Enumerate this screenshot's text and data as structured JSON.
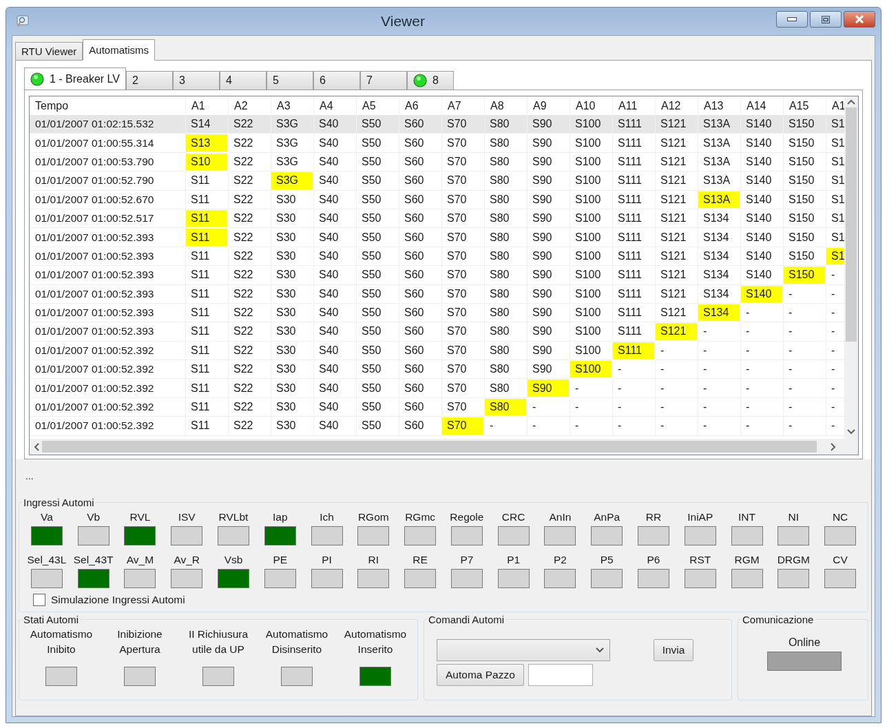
{
  "window": {
    "title": "Viewer"
  },
  "tabs": [
    {
      "label": "RTU Viewer",
      "selected": false
    },
    {
      "label": "Automatisms",
      "selected": true
    }
  ],
  "inner_tabs": [
    {
      "label": "1 - Breaker LV",
      "selected": true,
      "led": true
    },
    {
      "label": "2",
      "selected": false,
      "led": false
    },
    {
      "label": "3",
      "selected": false,
      "led": false
    },
    {
      "label": "4",
      "selected": false,
      "led": false
    },
    {
      "label": "5",
      "selected": false,
      "led": false
    },
    {
      "label": "6",
      "selected": false,
      "led": false
    },
    {
      "label": "7",
      "selected": false,
      "led": false
    },
    {
      "label": "8",
      "selected": false,
      "led": true
    }
  ],
  "table": {
    "time_header": "Tempo",
    "columns": [
      "A1",
      "A2",
      "A3",
      "A4",
      "A5",
      "A6",
      "A7",
      "A8",
      "A9",
      "A10",
      "A11",
      "A12",
      "A13",
      "A14",
      "A15",
      "A1"
    ],
    "rows": [
      {
        "time": "01/01/2007 01:02:15.532",
        "selected": true,
        "cells": [
          {
            "text": "S14",
            "highlighted": false
          },
          {
            "text": "S22",
            "highlighted": false
          },
          {
            "text": "S3G",
            "highlighted": false
          },
          {
            "text": "S40",
            "highlighted": false
          },
          {
            "text": "S50",
            "highlighted": false
          },
          {
            "text": "S60",
            "highlighted": false
          },
          {
            "text": "S70",
            "highlighted": false
          },
          {
            "text": "S80",
            "highlighted": false
          },
          {
            "text": "S90",
            "highlighted": false
          },
          {
            "text": "S100",
            "highlighted": false
          },
          {
            "text": "S111",
            "highlighted": false
          },
          {
            "text": "S121",
            "highlighted": false
          },
          {
            "text": "S13A",
            "highlighted": false
          },
          {
            "text": "S140",
            "highlighted": false
          },
          {
            "text": "S150",
            "highlighted": false
          },
          {
            "text": "S1",
            "highlighted": false
          }
        ]
      },
      {
        "time": "01/01/2007 01:00:55.314",
        "selected": false,
        "cells": [
          {
            "text": "S13",
            "highlighted": true
          },
          {
            "text": "S22",
            "highlighted": false
          },
          {
            "text": "S3G",
            "highlighted": false
          },
          {
            "text": "S40",
            "highlighted": false
          },
          {
            "text": "S50",
            "highlighted": false
          },
          {
            "text": "S60",
            "highlighted": false
          },
          {
            "text": "S70",
            "highlighted": false
          },
          {
            "text": "S80",
            "highlighted": false
          },
          {
            "text": "S90",
            "highlighted": false
          },
          {
            "text": "S100",
            "highlighted": false
          },
          {
            "text": "S111",
            "highlighted": false
          },
          {
            "text": "S121",
            "highlighted": false
          },
          {
            "text": "S13A",
            "highlighted": false
          },
          {
            "text": "S140",
            "highlighted": false
          },
          {
            "text": "S150",
            "highlighted": false
          },
          {
            "text": "S1",
            "highlighted": false
          }
        ]
      },
      {
        "time": "01/01/2007 01:00:53.790",
        "selected": false,
        "cells": [
          {
            "text": "S10",
            "highlighted": true
          },
          {
            "text": "S22",
            "highlighted": false
          },
          {
            "text": "S3G",
            "highlighted": false
          },
          {
            "text": "S40",
            "highlighted": false
          },
          {
            "text": "S50",
            "highlighted": false
          },
          {
            "text": "S60",
            "highlighted": false
          },
          {
            "text": "S70",
            "highlighted": false
          },
          {
            "text": "S80",
            "highlighted": false
          },
          {
            "text": "S90",
            "highlighted": false
          },
          {
            "text": "S100",
            "highlighted": false
          },
          {
            "text": "S111",
            "highlighted": false
          },
          {
            "text": "S121",
            "highlighted": false
          },
          {
            "text": "S13A",
            "highlighted": false
          },
          {
            "text": "S140",
            "highlighted": false
          },
          {
            "text": "S150",
            "highlighted": false
          },
          {
            "text": "S1",
            "highlighted": false
          }
        ]
      },
      {
        "time": "01/01/2007 01:00:52.790",
        "selected": false,
        "cells": [
          {
            "text": "S11",
            "highlighted": false
          },
          {
            "text": "S22",
            "highlighted": false
          },
          {
            "text": "S3G",
            "highlighted": true
          },
          {
            "text": "S40",
            "highlighted": false
          },
          {
            "text": "S50",
            "highlighted": false
          },
          {
            "text": "S60",
            "highlighted": false
          },
          {
            "text": "S70",
            "highlighted": false
          },
          {
            "text": "S80",
            "highlighted": false
          },
          {
            "text": "S90",
            "highlighted": false
          },
          {
            "text": "S100",
            "highlighted": false
          },
          {
            "text": "S111",
            "highlighted": false
          },
          {
            "text": "S121",
            "highlighted": false
          },
          {
            "text": "S13A",
            "highlighted": false
          },
          {
            "text": "S140",
            "highlighted": false
          },
          {
            "text": "S150",
            "highlighted": false
          },
          {
            "text": "S1",
            "highlighted": false
          }
        ]
      },
      {
        "time": "01/01/2007 01:00:52.670",
        "selected": false,
        "cells": [
          {
            "text": "S11",
            "highlighted": false
          },
          {
            "text": "S22",
            "highlighted": false
          },
          {
            "text": "S30",
            "highlighted": false
          },
          {
            "text": "S40",
            "highlighted": false
          },
          {
            "text": "S50",
            "highlighted": false
          },
          {
            "text": "S60",
            "highlighted": false
          },
          {
            "text": "S70",
            "highlighted": false
          },
          {
            "text": "S80",
            "highlighted": false
          },
          {
            "text": "S90",
            "highlighted": false
          },
          {
            "text": "S100",
            "highlighted": false
          },
          {
            "text": "S111",
            "highlighted": false
          },
          {
            "text": "S121",
            "highlighted": false
          },
          {
            "text": "S13A",
            "highlighted": true
          },
          {
            "text": "S140",
            "highlighted": false
          },
          {
            "text": "S150",
            "highlighted": false
          },
          {
            "text": "S1",
            "highlighted": false
          }
        ]
      },
      {
        "time": "01/01/2007 01:00:52.517",
        "selected": false,
        "cells": [
          {
            "text": "S11",
            "highlighted": true
          },
          {
            "text": "S22",
            "highlighted": false
          },
          {
            "text": "S30",
            "highlighted": false
          },
          {
            "text": "S40",
            "highlighted": false
          },
          {
            "text": "S50",
            "highlighted": false
          },
          {
            "text": "S60",
            "highlighted": false
          },
          {
            "text": "S70",
            "highlighted": false
          },
          {
            "text": "S80",
            "highlighted": false
          },
          {
            "text": "S90",
            "highlighted": false
          },
          {
            "text": "S100",
            "highlighted": false
          },
          {
            "text": "S111",
            "highlighted": false
          },
          {
            "text": "S121",
            "highlighted": false
          },
          {
            "text": "S134",
            "highlighted": false
          },
          {
            "text": "S140",
            "highlighted": false
          },
          {
            "text": "S150",
            "highlighted": false
          },
          {
            "text": "S1",
            "highlighted": false
          }
        ]
      },
      {
        "time": "01/01/2007 01:00:52.393",
        "selected": false,
        "cells": [
          {
            "text": "S11",
            "highlighted": true
          },
          {
            "text": "S22",
            "highlighted": false
          },
          {
            "text": "S30",
            "highlighted": false
          },
          {
            "text": "S40",
            "highlighted": false
          },
          {
            "text": "S50",
            "highlighted": false
          },
          {
            "text": "S60",
            "highlighted": false
          },
          {
            "text": "S70",
            "highlighted": false
          },
          {
            "text": "S80",
            "highlighted": false
          },
          {
            "text": "S90",
            "highlighted": false
          },
          {
            "text": "S100",
            "highlighted": false
          },
          {
            "text": "S111",
            "highlighted": false
          },
          {
            "text": "S121",
            "highlighted": false
          },
          {
            "text": "S134",
            "highlighted": false
          },
          {
            "text": "S140",
            "highlighted": false
          },
          {
            "text": "S150",
            "highlighted": false
          },
          {
            "text": "S1",
            "highlighted": false
          }
        ]
      },
      {
        "time": "01/01/2007 01:00:52.393",
        "selected": false,
        "cells": [
          {
            "text": "S11",
            "highlighted": false
          },
          {
            "text": "S22",
            "highlighted": false
          },
          {
            "text": "S30",
            "highlighted": false
          },
          {
            "text": "S40",
            "highlighted": false
          },
          {
            "text": "S50",
            "highlighted": false
          },
          {
            "text": "S60",
            "highlighted": false
          },
          {
            "text": "S70",
            "highlighted": false
          },
          {
            "text": "S80",
            "highlighted": false
          },
          {
            "text": "S90",
            "highlighted": false
          },
          {
            "text": "S100",
            "highlighted": false
          },
          {
            "text": "S111",
            "highlighted": false
          },
          {
            "text": "S121",
            "highlighted": false
          },
          {
            "text": "S134",
            "highlighted": false
          },
          {
            "text": "S140",
            "highlighted": false
          },
          {
            "text": "S150",
            "highlighted": false
          },
          {
            "text": "S1",
            "highlighted": true
          }
        ]
      },
      {
        "time": "01/01/2007 01:00:52.393",
        "selected": false,
        "cells": [
          {
            "text": "S11",
            "highlighted": false
          },
          {
            "text": "S22",
            "highlighted": false
          },
          {
            "text": "S30",
            "highlighted": false
          },
          {
            "text": "S40",
            "highlighted": false
          },
          {
            "text": "S50",
            "highlighted": false
          },
          {
            "text": "S60",
            "highlighted": false
          },
          {
            "text": "S70",
            "highlighted": false
          },
          {
            "text": "S80",
            "highlighted": false
          },
          {
            "text": "S90",
            "highlighted": false
          },
          {
            "text": "S100",
            "highlighted": false
          },
          {
            "text": "S111",
            "highlighted": false
          },
          {
            "text": "S121",
            "highlighted": false
          },
          {
            "text": "S134",
            "highlighted": false
          },
          {
            "text": "S140",
            "highlighted": false
          },
          {
            "text": "S150",
            "highlighted": true
          },
          {
            "text": "-",
            "highlighted": false
          }
        ]
      },
      {
        "time": "01/01/2007 01:00:52.393",
        "selected": false,
        "cells": [
          {
            "text": "S11",
            "highlighted": false
          },
          {
            "text": "S22",
            "highlighted": false
          },
          {
            "text": "S30",
            "highlighted": false
          },
          {
            "text": "S40",
            "highlighted": false
          },
          {
            "text": "S50",
            "highlighted": false
          },
          {
            "text": "S60",
            "highlighted": false
          },
          {
            "text": "S70",
            "highlighted": false
          },
          {
            "text": "S80",
            "highlighted": false
          },
          {
            "text": "S90",
            "highlighted": false
          },
          {
            "text": "S100",
            "highlighted": false
          },
          {
            "text": "S111",
            "highlighted": false
          },
          {
            "text": "S121",
            "highlighted": false
          },
          {
            "text": "S134",
            "highlighted": false
          },
          {
            "text": "S140",
            "highlighted": true
          },
          {
            "text": "-",
            "highlighted": false
          },
          {
            "text": "-",
            "highlighted": false
          }
        ]
      },
      {
        "time": "01/01/2007 01:00:52.393",
        "selected": false,
        "cells": [
          {
            "text": "S11",
            "highlighted": false
          },
          {
            "text": "S22",
            "highlighted": false
          },
          {
            "text": "S30",
            "highlighted": false
          },
          {
            "text": "S40",
            "highlighted": false
          },
          {
            "text": "S50",
            "highlighted": false
          },
          {
            "text": "S60",
            "highlighted": false
          },
          {
            "text": "S70",
            "highlighted": false
          },
          {
            "text": "S80",
            "highlighted": false
          },
          {
            "text": "S90",
            "highlighted": false
          },
          {
            "text": "S100",
            "highlighted": false
          },
          {
            "text": "S111",
            "highlighted": false
          },
          {
            "text": "S121",
            "highlighted": false
          },
          {
            "text": "S134",
            "highlighted": true
          },
          {
            "text": "-",
            "highlighted": false
          },
          {
            "text": "-",
            "highlighted": false
          },
          {
            "text": "-",
            "highlighted": false
          }
        ]
      },
      {
        "time": "01/01/2007 01:00:52.393",
        "selected": false,
        "cells": [
          {
            "text": "S11",
            "highlighted": false
          },
          {
            "text": "S22",
            "highlighted": false
          },
          {
            "text": "S30",
            "highlighted": false
          },
          {
            "text": "S40",
            "highlighted": false
          },
          {
            "text": "S50",
            "highlighted": false
          },
          {
            "text": "S60",
            "highlighted": false
          },
          {
            "text": "S70",
            "highlighted": false
          },
          {
            "text": "S80",
            "highlighted": false
          },
          {
            "text": "S90",
            "highlighted": false
          },
          {
            "text": "S100",
            "highlighted": false
          },
          {
            "text": "S111",
            "highlighted": false
          },
          {
            "text": "S121",
            "highlighted": true
          },
          {
            "text": "-",
            "highlighted": false
          },
          {
            "text": "-",
            "highlighted": false
          },
          {
            "text": "-",
            "highlighted": false
          },
          {
            "text": "-",
            "highlighted": false
          }
        ]
      },
      {
        "time": "01/01/2007 01:00:52.392",
        "selected": false,
        "cells": [
          {
            "text": "S11",
            "highlighted": false
          },
          {
            "text": "S22",
            "highlighted": false
          },
          {
            "text": "S30",
            "highlighted": false
          },
          {
            "text": "S40",
            "highlighted": false
          },
          {
            "text": "S50",
            "highlighted": false
          },
          {
            "text": "S60",
            "highlighted": false
          },
          {
            "text": "S70",
            "highlighted": false
          },
          {
            "text": "S80",
            "highlighted": false
          },
          {
            "text": "S90",
            "highlighted": false
          },
          {
            "text": "S100",
            "highlighted": false
          },
          {
            "text": "S111",
            "highlighted": true
          },
          {
            "text": "-",
            "highlighted": false
          },
          {
            "text": "-",
            "highlighted": false
          },
          {
            "text": "-",
            "highlighted": false
          },
          {
            "text": "-",
            "highlighted": false
          },
          {
            "text": "-",
            "highlighted": false
          }
        ]
      },
      {
        "time": "01/01/2007 01:00:52.392",
        "selected": false,
        "cells": [
          {
            "text": "S11",
            "highlighted": false
          },
          {
            "text": "S22",
            "highlighted": false
          },
          {
            "text": "S30",
            "highlighted": false
          },
          {
            "text": "S40",
            "highlighted": false
          },
          {
            "text": "S50",
            "highlighted": false
          },
          {
            "text": "S60",
            "highlighted": false
          },
          {
            "text": "S70",
            "highlighted": false
          },
          {
            "text": "S80",
            "highlighted": false
          },
          {
            "text": "S90",
            "highlighted": false
          },
          {
            "text": "S100",
            "highlighted": true
          },
          {
            "text": "-",
            "highlighted": false
          },
          {
            "text": "-",
            "highlighted": false
          },
          {
            "text": "-",
            "highlighted": false
          },
          {
            "text": "-",
            "highlighted": false
          },
          {
            "text": "-",
            "highlighted": false
          },
          {
            "text": "-",
            "highlighted": false
          }
        ]
      },
      {
        "time": "01/01/2007 01:00:52.392",
        "selected": false,
        "cells": [
          {
            "text": "S11",
            "highlighted": false
          },
          {
            "text": "S22",
            "highlighted": false
          },
          {
            "text": "S30",
            "highlighted": false
          },
          {
            "text": "S40",
            "highlighted": false
          },
          {
            "text": "S50",
            "highlighted": false
          },
          {
            "text": "S60",
            "highlighted": false
          },
          {
            "text": "S70",
            "highlighted": false
          },
          {
            "text": "S80",
            "highlighted": false
          },
          {
            "text": "S90",
            "highlighted": true
          },
          {
            "text": "-",
            "highlighted": false
          },
          {
            "text": "-",
            "highlighted": false
          },
          {
            "text": "-",
            "highlighted": false
          },
          {
            "text": "-",
            "highlighted": false
          },
          {
            "text": "-",
            "highlighted": false
          },
          {
            "text": "-",
            "highlighted": false
          },
          {
            "text": "-",
            "highlighted": false
          }
        ]
      },
      {
        "time": "01/01/2007 01:00:52.392",
        "selected": false,
        "cells": [
          {
            "text": "S11",
            "highlighted": false
          },
          {
            "text": "S22",
            "highlighted": false
          },
          {
            "text": "S30",
            "highlighted": false
          },
          {
            "text": "S40",
            "highlighted": false
          },
          {
            "text": "S50",
            "highlighted": false
          },
          {
            "text": "S60",
            "highlighted": false
          },
          {
            "text": "S70",
            "highlighted": false
          },
          {
            "text": "S80",
            "highlighted": true
          },
          {
            "text": "-",
            "highlighted": false
          },
          {
            "text": "-",
            "highlighted": false
          },
          {
            "text": "-",
            "highlighted": false
          },
          {
            "text": "-",
            "highlighted": false
          },
          {
            "text": "-",
            "highlighted": false
          },
          {
            "text": "-",
            "highlighted": false
          },
          {
            "text": "-",
            "highlighted": false
          },
          {
            "text": "-",
            "highlighted": false
          }
        ]
      },
      {
        "time": "01/01/2007 01:00:52.392",
        "selected": false,
        "cells": [
          {
            "text": "S11",
            "highlighted": false
          },
          {
            "text": "S22",
            "highlighted": false
          },
          {
            "text": "S30",
            "highlighted": false
          },
          {
            "text": "S40",
            "highlighted": false
          },
          {
            "text": "S50",
            "highlighted": false
          },
          {
            "text": "S60",
            "highlighted": false
          },
          {
            "text": "S70",
            "highlighted": true
          },
          {
            "text": "-",
            "highlighted": false
          },
          {
            "text": "-",
            "highlighted": false
          },
          {
            "text": "-",
            "highlighted": false
          },
          {
            "text": "-",
            "highlighted": false
          },
          {
            "text": "-",
            "highlighted": false
          },
          {
            "text": "-",
            "highlighted": false
          },
          {
            "text": "-",
            "highlighted": false
          },
          {
            "text": "-",
            "highlighted": false
          },
          {
            "text": "-",
            "highlighted": false
          }
        ]
      }
    ]
  },
  "status_text": "...",
  "ingressi": {
    "title": "Ingressi Automi",
    "items": [
      {
        "label": "Va",
        "on": true
      },
      {
        "label": "Vb",
        "on": false
      },
      {
        "label": "RVL",
        "on": true
      },
      {
        "label": "ISV",
        "on": false
      },
      {
        "label": "RVLbt",
        "on": false
      },
      {
        "label": "Iap",
        "on": true
      },
      {
        "label": "Ich",
        "on": false
      },
      {
        "label": "RGom",
        "on": false
      },
      {
        "label": "RGmc",
        "on": false
      },
      {
        "label": "Regole",
        "on": false
      },
      {
        "label": "CRC",
        "on": false
      },
      {
        "label": "AnIn",
        "on": false
      },
      {
        "label": "AnPa",
        "on": false
      },
      {
        "label": "RR",
        "on": false
      },
      {
        "label": "IniAP",
        "on": false
      },
      {
        "label": "INT",
        "on": false
      },
      {
        "label": "NI",
        "on": false
      },
      {
        "label": "NC",
        "on": false
      },
      {
        "label": "Sel_43L",
        "on": false
      },
      {
        "label": "Sel_43T",
        "on": true
      },
      {
        "label": "Av_M",
        "on": false
      },
      {
        "label": "Av_R",
        "on": false
      },
      {
        "label": "Vsb",
        "on": true
      },
      {
        "label": "PE",
        "on": false
      },
      {
        "label": "PI",
        "on": false
      },
      {
        "label": "RI",
        "on": false
      },
      {
        "label": "RE",
        "on": false
      },
      {
        "label": "P7",
        "on": false
      },
      {
        "label": "P1",
        "on": false
      },
      {
        "label": "P2",
        "on": false
      },
      {
        "label": "P5",
        "on": false
      },
      {
        "label": "P6",
        "on": false
      },
      {
        "label": "RST",
        "on": false
      },
      {
        "label": "RGM",
        "on": false
      },
      {
        "label": "DRGM",
        "on": false
      },
      {
        "label": "CV",
        "on": false
      }
    ],
    "simulation": {
      "label": "Simulazione Ingressi Automi",
      "checked": false
    }
  },
  "stati": {
    "title": "Stati Automi",
    "items": [
      {
        "label": "Automatismo Inibito",
        "on": false
      },
      {
        "label": "Inibizione Apertura",
        "on": false
      },
      {
        "label": "II Richiusura utile da UP",
        "on": false
      },
      {
        "label": "Automatismo Disinserito",
        "on": false
      },
      {
        "label": "Automatismo Inserito",
        "on": true
      }
    ]
  },
  "comandi": {
    "title": "Comandi Automi",
    "send_button": "Invia",
    "crazy_button": "Automa Pazzo"
  },
  "comunicazione": {
    "title": "Comunicazione",
    "label": "Online",
    "on": false
  }
}
